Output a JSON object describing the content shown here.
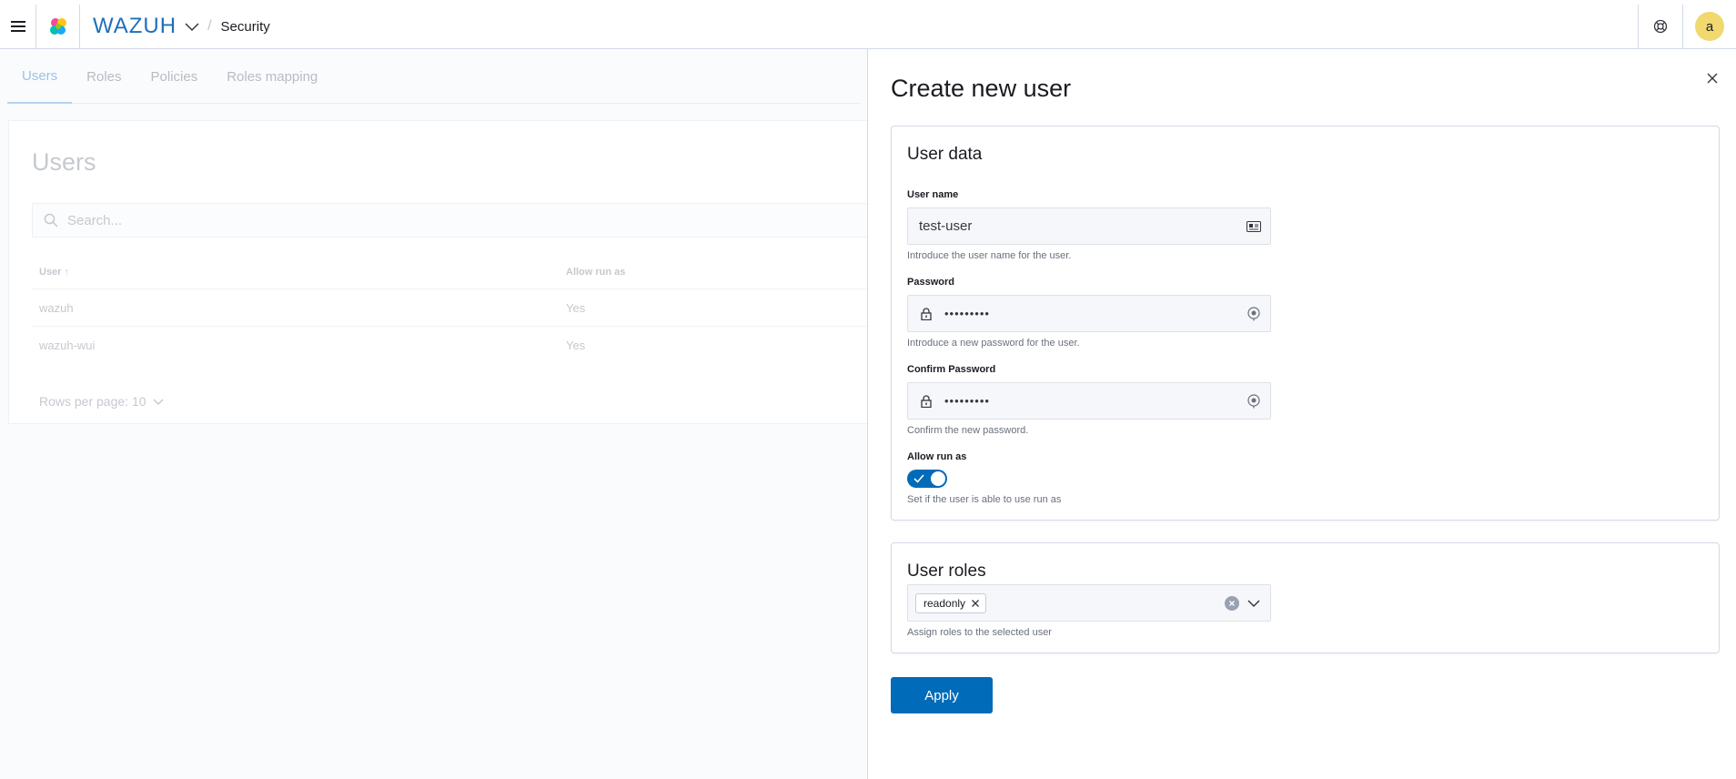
{
  "header": {
    "brand": "WAZUH",
    "breadcrumb": "Security",
    "avatar_initial": "a",
    "brand_color": "#1e6fb9",
    "avatar_color": "#f1d86f"
  },
  "background": {
    "tabs": [
      "Users",
      "Roles",
      "Policies",
      "Roles mapping"
    ],
    "active_tab": "Users",
    "panel_title": "Users",
    "search_placeholder": "Search...",
    "columns": [
      "User",
      "Allow run as"
    ],
    "rows": [
      {
        "user": "wazuh",
        "allow_run_as": "Yes"
      },
      {
        "user": "wazuh-wui",
        "allow_run_as": "Yes"
      }
    ],
    "rows_per_page": "Rows per page: 10"
  },
  "flyout": {
    "title": "Create new user",
    "user_data": {
      "title": "User data",
      "username_label": "User name",
      "username_value": "test-user",
      "username_help": "Introduce the user name for the user.",
      "password_label": "Password",
      "password_value": "•••••••••",
      "password_help": "Introduce a new password for the user.",
      "confirm_label": "Confirm Password",
      "confirm_value": "•••••••••",
      "confirm_help": "Confirm the new password.",
      "run_as_label": "Allow run as",
      "run_as_enabled": true,
      "run_as_help": "Set if the user is able to use run as"
    },
    "user_roles": {
      "title": "User roles",
      "selected": [
        "readonly"
      ],
      "help": "Assign roles to the selected user"
    },
    "apply_label": "Apply",
    "primary_color": "#006bb8"
  }
}
